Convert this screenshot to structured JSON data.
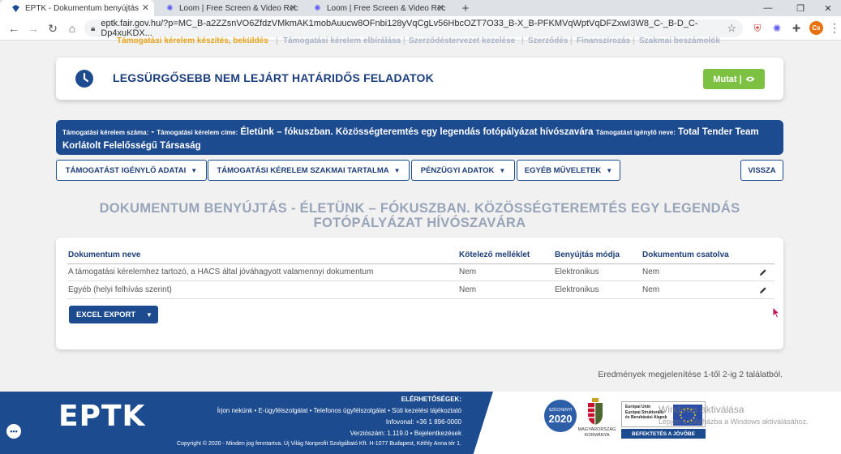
{
  "browser": {
    "tabs": [
      {
        "title": "EPTK - Dokumentum benyújtás",
        "active": true
      },
      {
        "title": "Loom | Free Screen & Video Rec",
        "active": false
      },
      {
        "title": "Loom | Free Screen & Video Rec",
        "active": false
      }
    ],
    "url": "eptk.fair.gov.hu/?p=MC_B-a2ZZsnVO6ZfdzVMkmAK1mobAuucw8OFnbi128yVqCgLv56HbcOZT7O33_B-X_B-PFKMVqWptVqDFZxwI3W8_C-_B-D_C-Dp4xuKDX...",
    "profile_initials": "Cs"
  },
  "topnav": {
    "items": [
      "Támogatási kérelem készítés, beküldés",
      "Támogatási kérelem elbírálása",
      "Szerződéstervezet kezelése",
      "Szerződés",
      "Finanszírozás",
      "Szakmai beszámolók"
    ]
  },
  "deadline": {
    "title": "LEGSÜRGŐSEBB NEM LEJÁRT HATÁRIDŐS FELADATOK",
    "button": "Mutat |"
  },
  "application": {
    "number_label": "Támogatási kérelem száma:",
    "number_value": "-",
    "title_label": "Támogatási kérelem címe:",
    "title_value": "Életünk – fókuszban. Közösségteremtés egy legendás fotópályázat hívószavára",
    "applicant_label": "Támogatást igénylő neve:",
    "applicant_value_1": "Total Tender Team",
    "applicant_value_2": "Korlátolt Felelősségű Társaság"
  },
  "actions": {
    "applicant_data": "TÁMOGATÁST IGÉNYLŐ ADATAI",
    "professional_content": "TÁMOGATÁSI KÉRELEM SZAKMAI TARTALMA",
    "financial": "PÉNZÜGYI ADATOK",
    "other": "EGYÉB MŰVELETEK",
    "back": "VISSZA"
  },
  "page": {
    "title_line1": "DOKUMENTUM BENYÚJTÁS - ÉLETÜNK – FÓKUSZBAN. KÖZÖSSÉGTEREMTÉS EGY LEGENDÁS",
    "title_line2": "FOTÓPÁLYÁZAT HÍVÓSZAVÁRA"
  },
  "table": {
    "headers": [
      "Dokumentum neve",
      "Kötelező melléklet",
      "Benyújtás módja",
      "Dokumentum csatolva"
    ],
    "rows": [
      [
        "A támogatási kérelemhez tartozó, a HACS által jóváhagyott valamennyi dokumentum",
        "Nem",
        "Elektronikus",
        "Nem"
      ],
      [
        "Egyéb (helyi felhívás szerint)",
        "Nem",
        "Elektronikus",
        "Nem"
      ]
    ],
    "export_button": "EXCEL EXPORT",
    "results_text": "Eredmények megjelenítése 1-től 2-ig 2 találatból."
  },
  "footer": {
    "logo": "EPTK",
    "contacts_heading": "ELÉRHETŐSÉGEK:",
    "links": "Írjon nekünk • E-ügyfélszolgálat • Telefonos ügyfélszolgálat • Süti kezelési tájékoztató",
    "infovonal": "Infovonal: +36 1 896-0000",
    "version": "Verziószám: 1.119.0 • Bejelentkezések",
    "copyright": "Copyright © 2020 - Minden jog fenntartva. Új Világ Nonprofit Szolgáltató Kft. H-1077 Budapest, Kéthly Anna tér 1.",
    "szechenyi_small": "SZÉCHENYI",
    "szechenyi_year": "2020",
    "gov_line1": "MAGYARORSZÁG",
    "gov_line2": "KORMÁNYA",
    "eu_line1": "Európai Unió",
    "eu_line2": "Európai Strukturális",
    "eu_line3": "és Beruházási Alapok",
    "eu_strip": "BEFEKTETÉS A JÖVŐBE",
    "watermark_line1": "Windows aktiválása",
    "watermark_line2": "Lépjen a Gépházba a Windows aktiválásához."
  },
  "colors": {
    "primary": "#1d4b8f",
    "accent_green": "#7dc142",
    "nav_active": "#e8a319"
  }
}
